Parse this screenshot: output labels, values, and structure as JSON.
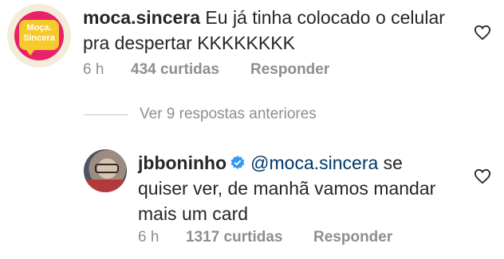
{
  "comments": {
    "main": {
      "username": "moca.sincera",
      "text": " Eu já tinha colocado o celular pra despertar KKKKKKKK",
      "time": "6 h",
      "likes": "434 curtidas",
      "reply_label": "Responder",
      "avatar_text_line1": "Moça.",
      "avatar_text_line2": "Sincera"
    },
    "view_replies": "Ver 9 respostas anteriores",
    "reply": {
      "username": "jbboninho",
      "mention": "@moca.sincera",
      "text": " se quiser ver, de manhã vamos mandar mais um card",
      "time": "6 h",
      "likes": "1317 curtidas",
      "reply_label": "Responder"
    }
  },
  "colors": {
    "text": "#262626",
    "meta": "#8e8e8e",
    "mention": "#00376b",
    "verified": "#3897f0"
  }
}
